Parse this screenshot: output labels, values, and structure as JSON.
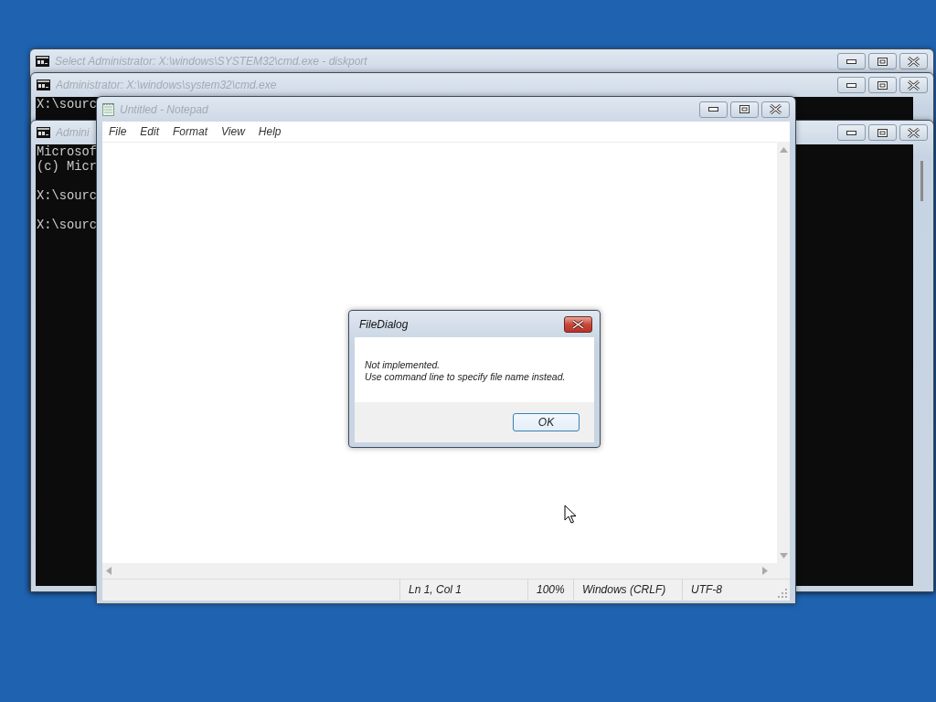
{
  "console_windows": [
    {
      "title": "Select Administrator: X:\\windows\\SYSTEM32\\cmd.exe - diskport"
    },
    {
      "title": "Administrator: X:\\windows\\system32\\cmd.exe",
      "blocks": [
        [
          "X:\\sourc"
        ]
      ]
    },
    {
      "title": "Admini",
      "blocks": [
        [
          "Microsof",
          "(c) Micr"
        ],
        [
          "X:\\sourc"
        ],
        [
          "X:\\sourc"
        ]
      ]
    }
  ],
  "notepad": {
    "title": "Untitled - Notepad",
    "menu": [
      "File",
      "Edit",
      "Format",
      "View",
      "Help"
    ],
    "status_bar": [
      "Ln 1, Col 1",
      "100%",
      "Windows (CRLF)",
      "UTF-8"
    ]
  },
  "dialog": {
    "title": "FileDialog",
    "message": [
      "Not implemented.",
      "Use command line to specify file name instead."
    ],
    "buttons": [
      "OK"
    ]
  }
}
